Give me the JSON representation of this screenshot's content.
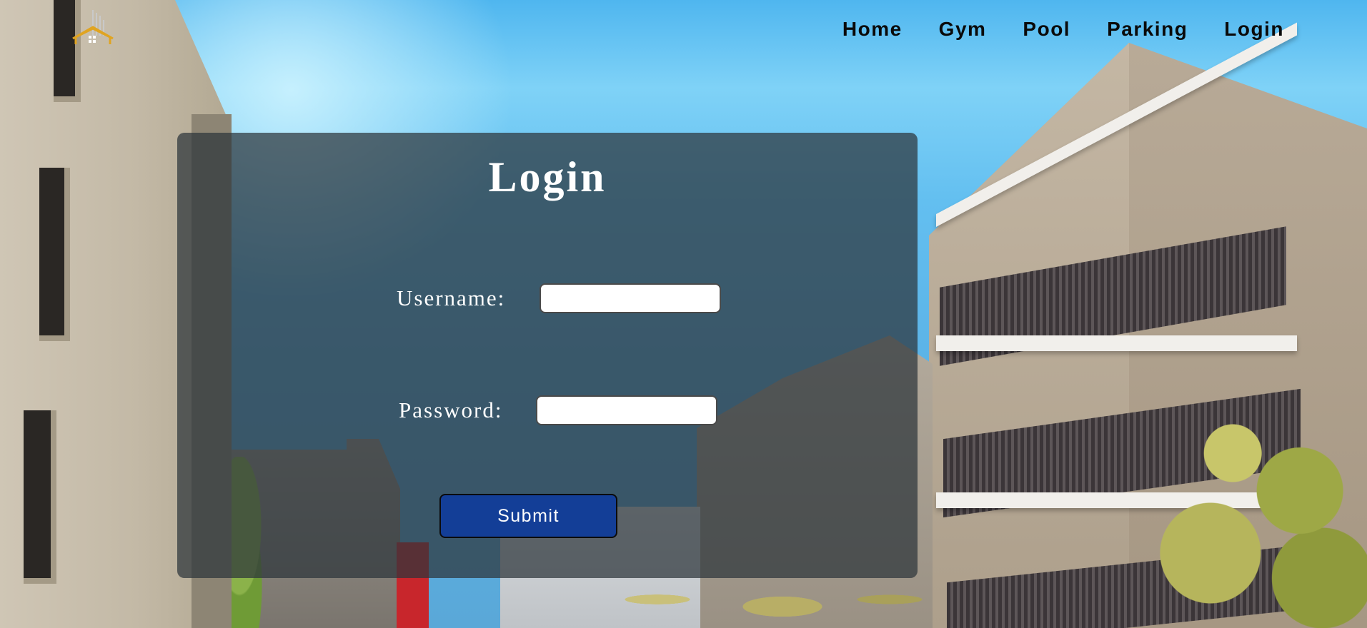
{
  "nav": {
    "items": [
      {
        "label": "Home"
      },
      {
        "label": "Gym"
      },
      {
        "label": "Pool"
      },
      {
        "label": "Parking"
      },
      {
        "label": "Login"
      }
    ]
  },
  "logo": {
    "icon": "house-building-logo-icon"
  },
  "login_form": {
    "title": "Login",
    "username_label": "Username:",
    "username_value": "",
    "password_label": "Password:",
    "password_value": "",
    "submit_label": "Submit"
  },
  "colors": {
    "submit_button": "#133e97",
    "panel_overlay": "#2d343a",
    "nav_text": "#0a0a0a",
    "logo_accent": "#e0a421"
  }
}
